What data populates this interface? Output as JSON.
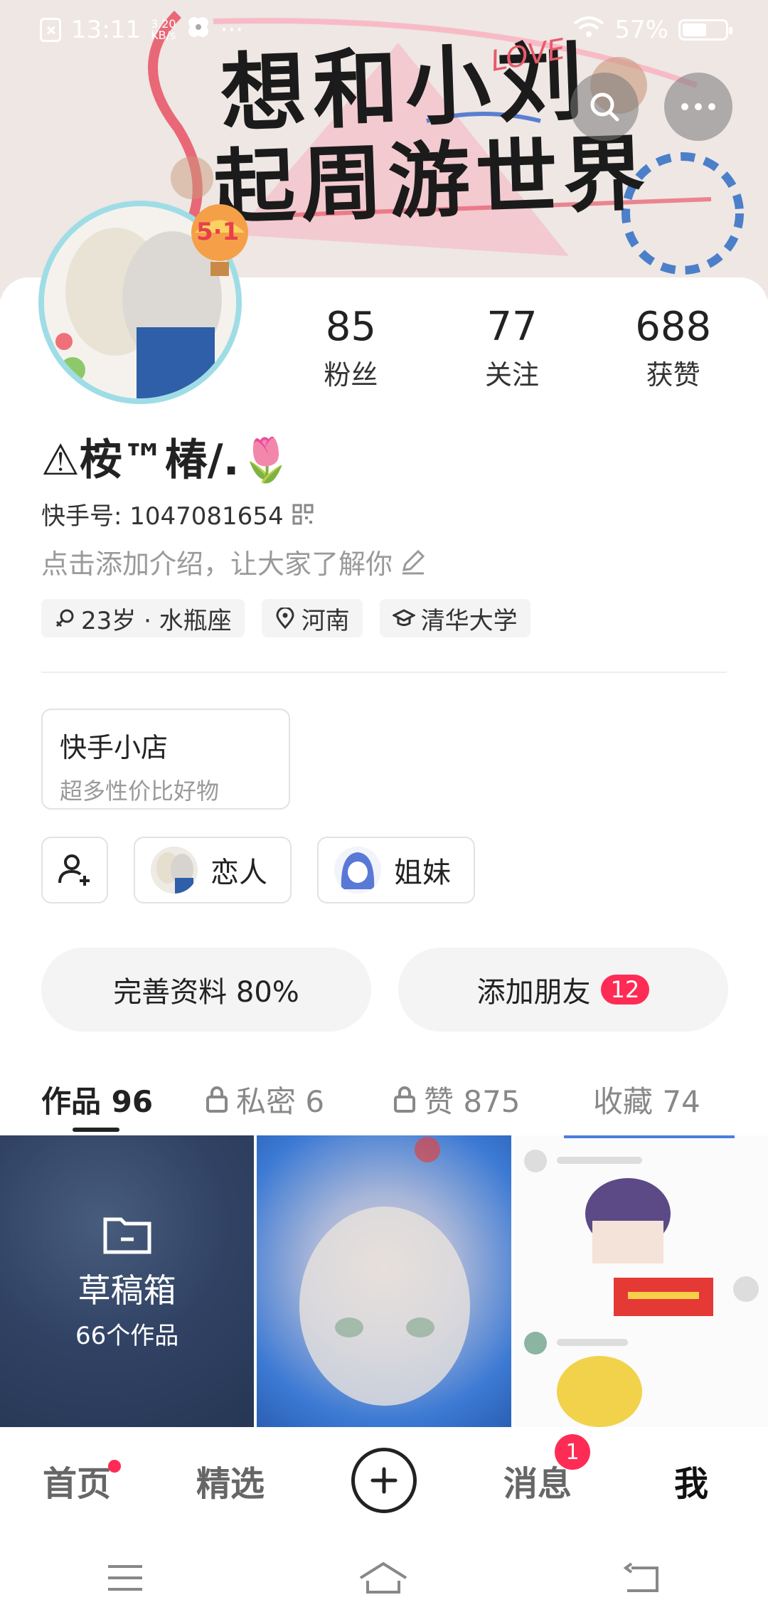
{
  "status_bar": {
    "time": "13:11",
    "net_speed_value": "3.20",
    "net_speed_unit": "KB/s",
    "more_dots": "···",
    "battery": "57%",
    "battery_level": 0.57
  },
  "banner": {
    "line1": "想和小刘",
    "line2": "起周游世界",
    "love": "LOVE"
  },
  "avatar_badge": "5·1",
  "stats": [
    {
      "num": "85",
      "label": "粉丝"
    },
    {
      "num": "77",
      "label": "关注"
    },
    {
      "num": "688",
      "label": "获赞"
    }
  ],
  "profile": {
    "name": "⚠桉™椿/.🌷",
    "uid": "快手号: 1047081654",
    "intro_placeholder": "点击添加介绍，让大家了解你"
  },
  "tags": [
    {
      "icon": "gender-icon",
      "label": "23岁 · 水瓶座"
    },
    {
      "icon": "location-pin-icon",
      "label": "河南"
    },
    {
      "icon": "graduation-cap-icon",
      "label": "清华大学"
    }
  ],
  "shop": {
    "title": "快手小店",
    "subtitle": "超多性价比好物"
  },
  "relations": [
    {
      "label": "恋人"
    },
    {
      "label": "姐妹"
    }
  ],
  "actions": {
    "complete_profile": "完善资料 80%",
    "add_friends": "添加朋友",
    "add_friends_count": "12"
  },
  "tabs": [
    {
      "label": "作品 96",
      "locked": false
    },
    {
      "label": "私密 6",
      "locked": true
    },
    {
      "label": "赞 875",
      "locked": true
    },
    {
      "label": "收藏 74",
      "locked": false
    }
  ],
  "grid": {
    "drafts_title": "草稿箱",
    "drafts_count": "66个作品"
  },
  "bottom_nav": {
    "home": "首页",
    "featured": "精选",
    "messages": "消息",
    "messages_badge": "1",
    "me": "我"
  },
  "colors": {
    "accent_red": "#fe2c55",
    "avatar_ring": "#9fdde6"
  }
}
